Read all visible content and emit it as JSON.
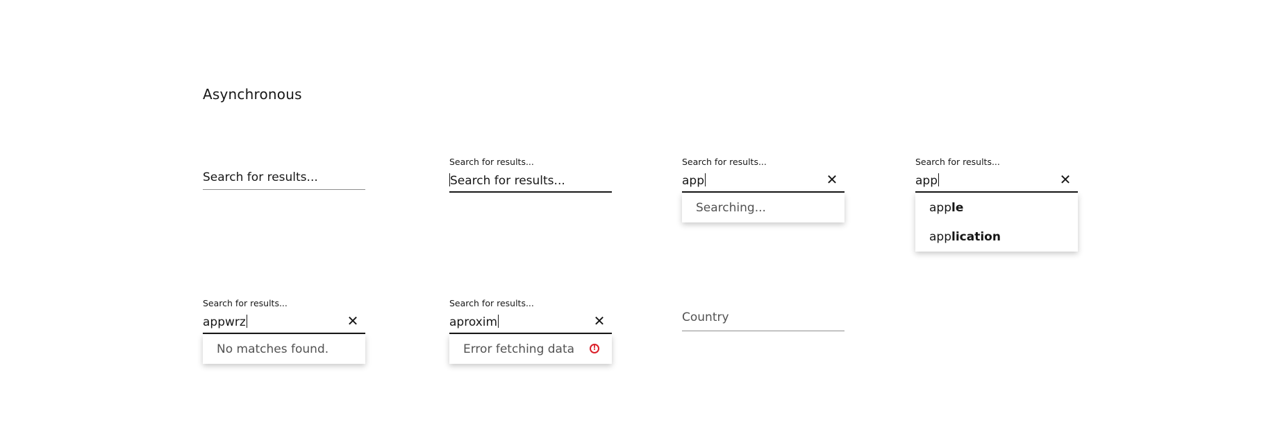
{
  "section_title": "Asynchronous",
  "fields": {
    "empty": {
      "placeholder": "Search for results..."
    },
    "focused": {
      "label": "Search for results...",
      "placeholder": "Search for results..."
    },
    "searching": {
      "label": "Search for results...",
      "value": "app",
      "status": "Searching..."
    },
    "results": {
      "label": "Search for results...",
      "value": "app",
      "options": [
        {
          "match": "app",
          "rest": "le"
        },
        {
          "match": "app",
          "rest": "lication"
        }
      ]
    },
    "no_match": {
      "label": "Search for results...",
      "value": "appwrz",
      "status": "No matches found."
    },
    "error": {
      "label": "Search for results...",
      "value": "aproxim",
      "status": "Error fetching data"
    },
    "country": {
      "placeholder": "Country"
    }
  },
  "icons": {
    "clear": "close-icon",
    "error": "error-circle-icon"
  },
  "colors": {
    "error": "#da1e28"
  }
}
